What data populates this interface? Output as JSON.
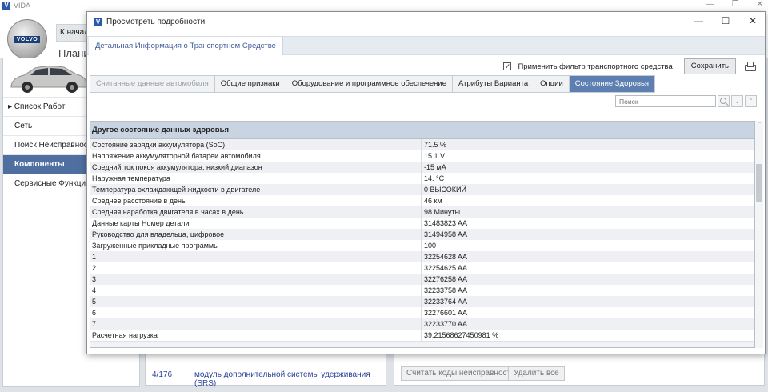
{
  "app": {
    "title": "VIDA",
    "logo_letter": "V",
    "window_controls": [
      "—",
      "❐",
      "✕"
    ],
    "brand_badge": "VOLVO",
    "home_label": "К началу",
    "plan_label": "Плани"
  },
  "sidebar": {
    "items": [
      {
        "label": "▸ Список Работ"
      },
      {
        "label": "Сеть"
      },
      {
        "label": "Поиск Неисправностей"
      },
      {
        "label": "Компоненты",
        "active": true
      },
      {
        "label": "Сервисные Функции"
      }
    ]
  },
  "background": {
    "list_rows": [
      {
        "code": "4/176",
        "text": "модуль дополнительной системы удерживания (SRS)"
      }
    ],
    "buttons": [
      "Считать коды неисправности",
      "Удалить все"
    ]
  },
  "dialog": {
    "title": "Просмотреть подробности",
    "logo_letter": "V",
    "window_controls": [
      "—",
      "☐",
      "✕"
    ],
    "band_tab": "Детальная Информация о Транспортном Средстве",
    "filter_checkbox_label": "Применить фильтр транспортного средства",
    "filter_checked": "✓",
    "save_label": "Сохранить",
    "tabs": [
      {
        "label": "Считанные данные автомобиля",
        "state": "disabled"
      },
      {
        "label": "Общие признаки",
        "state": "normal"
      },
      {
        "label": "Оборудование и программное обеспечение",
        "state": "normal"
      },
      {
        "label": "Атрибуты Варианта",
        "state": "normal"
      },
      {
        "label": "Опции",
        "state": "normal"
      },
      {
        "label": "Состояние Здоровья",
        "state": "active"
      }
    ],
    "search_placeholder": "Поиск",
    "grid": {
      "header": "Другое состояние данных здоровья",
      "rows": [
        {
          "name": "Состояние зарядки аккумулятора (SoC)",
          "value": "71.5 %"
        },
        {
          "name": "Напряжение аккумуляторной батареи автомобиля",
          "value": "15.1 V"
        },
        {
          "name": "Средний ток покоя аккумулятора, низкий диапазон",
          "value": "-15 мА"
        },
        {
          "name": "Наружная температура",
          "value": "14. °C"
        },
        {
          "name": "Температура охлаждающей жидкости в двигателе",
          "value": "0 ВЫСОКИЙ"
        },
        {
          "name": "Среднее расстояние в день",
          "value": "46 км"
        },
        {
          "name": "Средняя наработка двигателя в часах в день",
          "value": "98 Минуты"
        },
        {
          "name": "Данные карты Номер детали",
          "value": "31483823 AA"
        },
        {
          "name": "Руководство для владельца, цифровое",
          "value": "31494958 AA"
        },
        {
          "name": "Загруженные прикладные программы",
          "value": "100"
        },
        {
          "name": "1",
          "value": "32254628 AA"
        },
        {
          "name": "2",
          "value": "32254625 AA"
        },
        {
          "name": "3",
          "value": "32276258 AA"
        },
        {
          "name": "4",
          "value": "32233758 AA"
        },
        {
          "name": "5",
          "value": "32233764 AA"
        },
        {
          "name": "6",
          "value": "32276601 AA"
        },
        {
          "name": "7",
          "value": "32233770 AA"
        },
        {
          "name": "Расчетная нагрузка",
          "value": "39.21568627450981 %"
        }
      ]
    }
  }
}
